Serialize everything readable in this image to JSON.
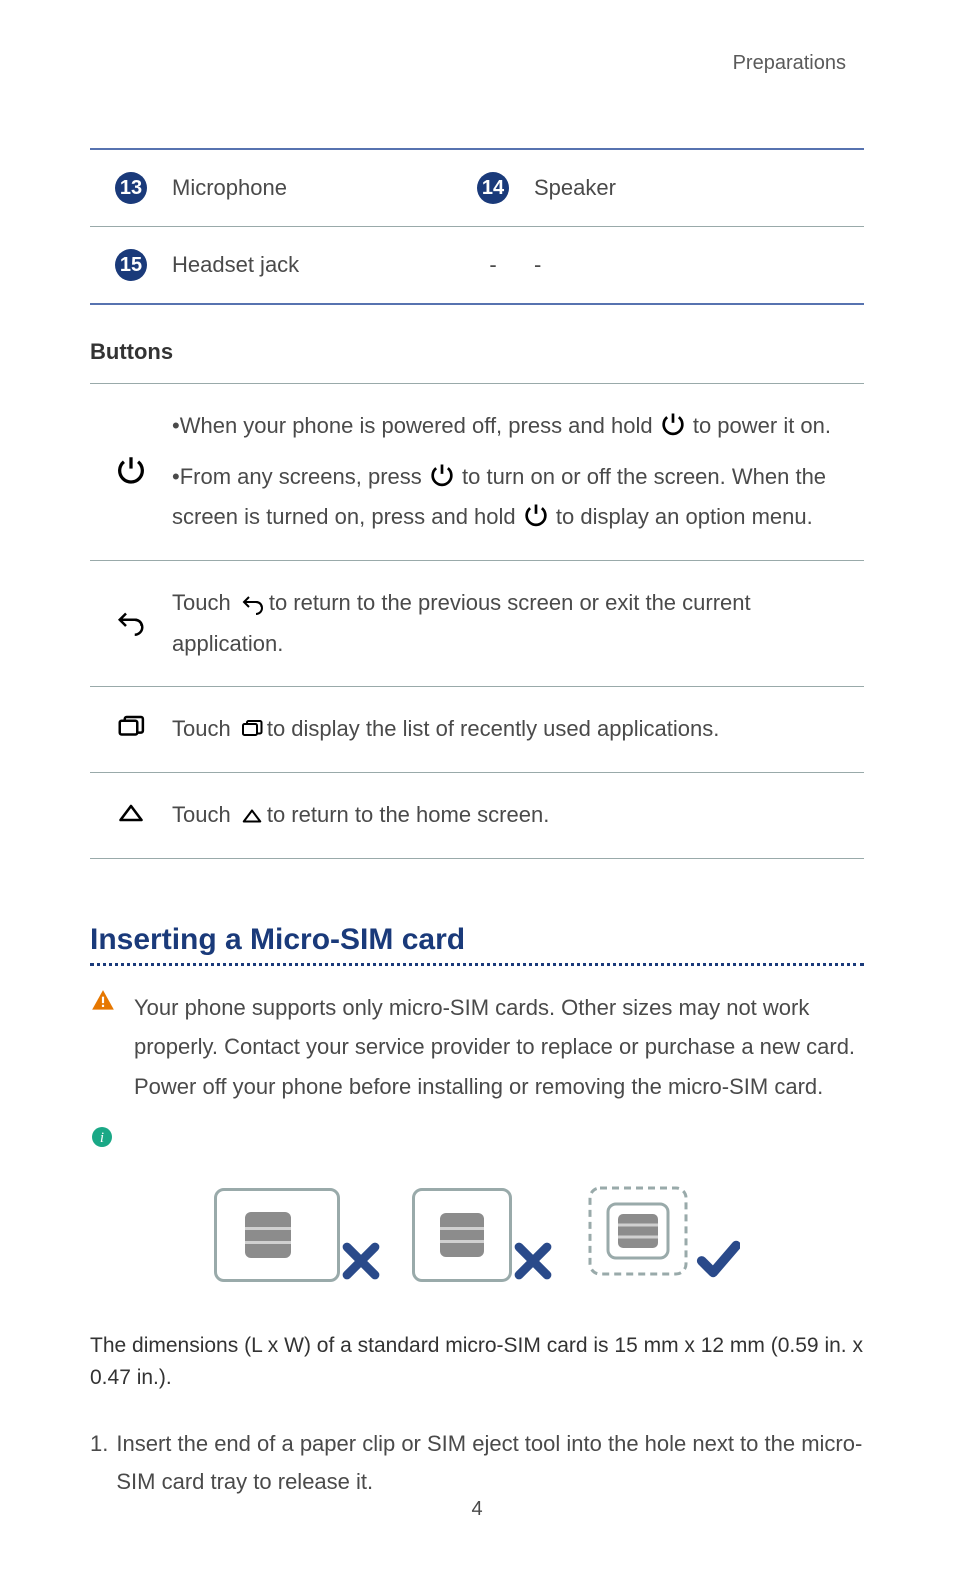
{
  "header": {
    "section": "Preparations"
  },
  "parts": {
    "rows": [
      {
        "num": "13",
        "label": "Microphone",
        "num2": "14",
        "label2": "Speaker"
      },
      {
        "num": "15",
        "label": "Headset jack",
        "num2": "-",
        "label2": "-"
      }
    ]
  },
  "buttons_heading": "Buttons",
  "buttons": {
    "power": {
      "bullet1_pre": "When your phone is powered off, press and hold ",
      "bullet1_post": " to power it on.",
      "bullet2_pre": "From any screens, press ",
      "bullet2_mid": " to turn on or off the screen. When the screen is turned on, press and hold ",
      "bullet2_post": " to display an option menu."
    },
    "back": {
      "pre": "Touch ",
      "post": "to return to the previous screen or exit the current application."
    },
    "recent": {
      "pre": "Touch ",
      "post": "to display the list of recently used applications."
    },
    "home": {
      "pre": "Touch ",
      "post": "to return to the home screen."
    }
  },
  "section_title": "Inserting a Micro-SIM card",
  "warning": "Your phone supports only micro-SIM cards. Other sizes may not work properly. Contact your service provider to replace or purchase a new card. Power off your phone before installing or removing the micro-SIM card.",
  "dimensions": "The dimensions (L x W) of a standard micro-SIM card is 15 mm x 12 mm (0.59 in. x 0.47 in.).",
  "step1": {
    "num": "1.",
    "text": "Insert the end of a paper clip or SIM eject tool into the hole next to the micro-SIM card tray to release it."
  },
  "page_number": "4"
}
